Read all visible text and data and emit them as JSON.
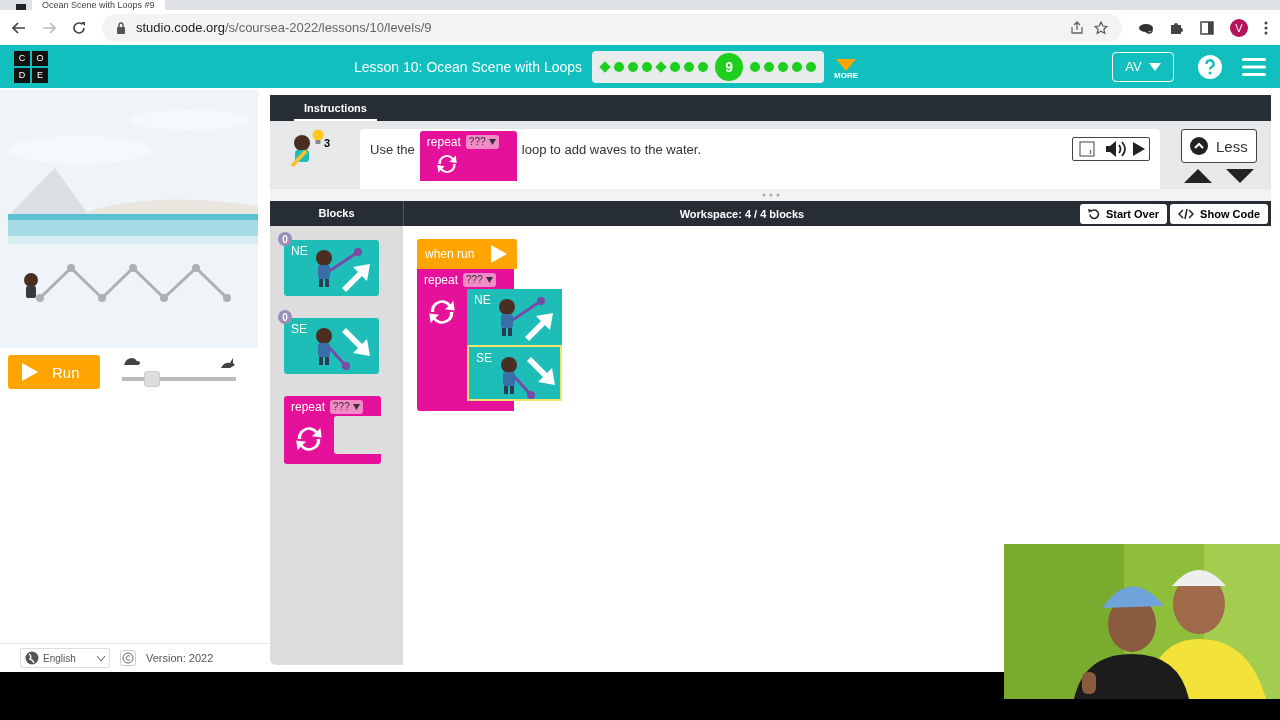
{
  "browser": {
    "tab_title": "Ocean Scene with Loops #9",
    "url_host": "studio.code.org",
    "url_path": "/s/coursea-2022/lessons/10/levels/9",
    "profile_initial": "V"
  },
  "header": {
    "logo_letters": [
      "C",
      "O",
      "D",
      "E"
    ],
    "lesson_title": "Lesson 10: Ocean Scene with Loops",
    "more_label": "MORE",
    "user_button": "AV",
    "levels": [
      {
        "kind": "assessment",
        "selected": false
      },
      {
        "kind": "puzzle",
        "selected": false
      },
      {
        "kind": "puzzle",
        "selected": false
      },
      {
        "kind": "puzzle",
        "selected": false
      },
      {
        "kind": "assessment",
        "selected": false
      },
      {
        "kind": "puzzle",
        "selected": false
      },
      {
        "kind": "puzzle",
        "selected": false
      },
      {
        "kind": "puzzle",
        "selected": false
      },
      {
        "kind": "puzzle",
        "selected": true,
        "label": "9"
      },
      {
        "kind": "puzzle",
        "selected": false
      },
      {
        "kind": "puzzle",
        "selected": false
      },
      {
        "kind": "puzzle",
        "selected": false
      },
      {
        "kind": "puzzle",
        "selected": false
      },
      {
        "kind": "puzzle",
        "selected": false
      }
    ]
  },
  "run_button": "Run",
  "speed_slider": {
    "level": 0.25
  },
  "footer": {
    "language": "English",
    "version": "Version: 2022"
  },
  "instructions": {
    "tab": "Instructions",
    "hint_count": "3",
    "text_before": "Use the",
    "text_after": "loop to add waves to the water.",
    "inline_block": {
      "label": "repeat",
      "value": "???"
    },
    "collapse_button": "Less"
  },
  "workspace_header": {
    "toolbox_title": "Blocks",
    "title": "Workspace: 4 / 4 blocks",
    "buttons": [
      "Start Over",
      "Show Code"
    ]
  },
  "toolbox": [
    {
      "kind": "northeast",
      "label": "NE",
      "count": "0"
    },
    {
      "kind": "southeast",
      "label": "SE",
      "count": "0"
    },
    {
      "kind": "repeat",
      "label": "repeat",
      "value": "???"
    }
  ],
  "workspace": {
    "event": "when run",
    "loop": {
      "label": "repeat",
      "value": "???"
    },
    "body": [
      {
        "kind": "northeast",
        "label": "NE",
        "selected": false
      },
      {
        "kind": "southeast",
        "label": "SE",
        "selected": true
      }
    ]
  }
}
